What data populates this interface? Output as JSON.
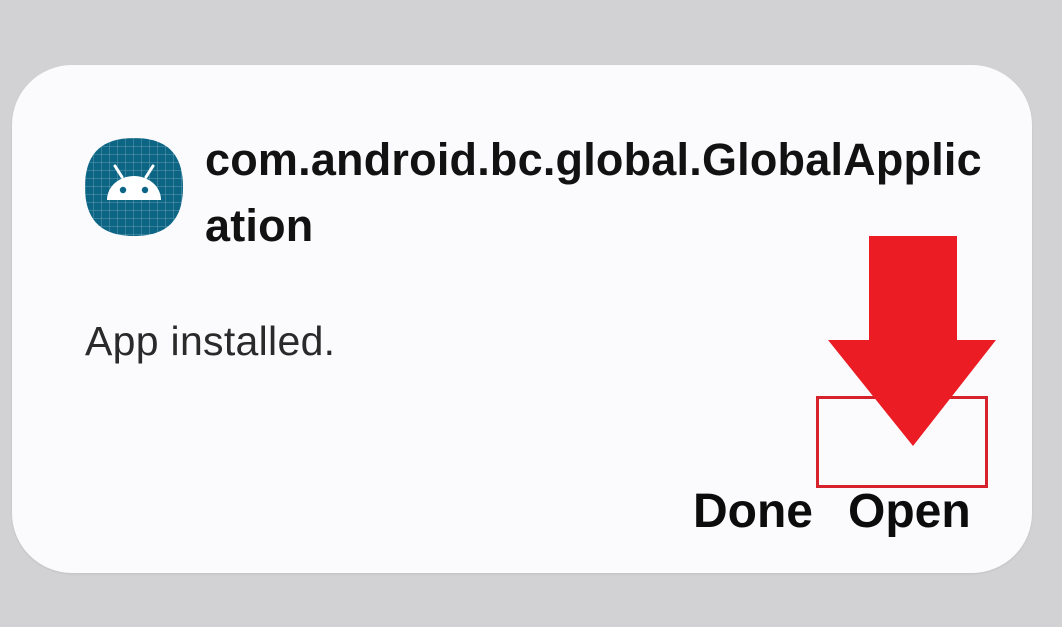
{
  "dialog": {
    "app_name": "com.android.bc.global.GlobalApplication",
    "message": "App installed.",
    "buttons": {
      "done_label": "Done",
      "open_label": "Open"
    },
    "icon": "android-app-icon"
  },
  "annotation": {
    "arrow_icon": "red-down-arrow-icon",
    "highlight_target": "open-button",
    "color": "#ec1c24"
  },
  "colors": {
    "scrim": "#d2d2d4",
    "dialog_bg": "#fbfbfe",
    "icon_bg": "#0d6585",
    "highlight_border": "#d6222b"
  }
}
